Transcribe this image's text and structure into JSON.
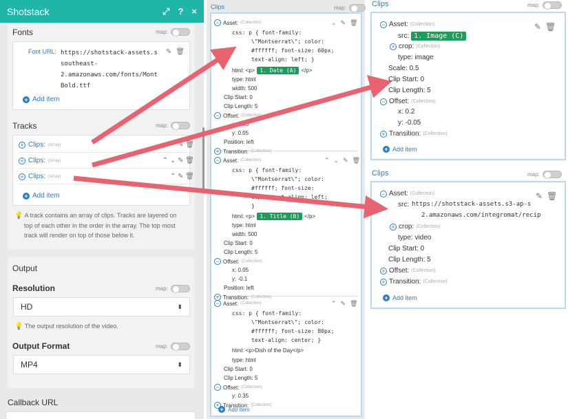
{
  "left": {
    "title": "Shotstack",
    "icons": {
      "expand": "⤢",
      "help": "?",
      "close": "×"
    },
    "fonts": {
      "heading": "Fonts",
      "map": "map:",
      "font_url_label": "Font URL:",
      "font_url_lines": [
        "https://shotstack-assets.s",
        "southeast-",
        "2.amazonaws.com/fonts/Mont",
        "Bold.ttf"
      ],
      "add_item": "Add item"
    },
    "tracks": {
      "heading": "Tracks",
      "map": "map:",
      "rows": [
        {
          "label": "Clips:",
          "type": "(Array)"
        },
        {
          "label": "Clips:",
          "type": "(Array)"
        },
        {
          "label": "Clips:",
          "type": "(Array)"
        }
      ],
      "add_item": "Add item",
      "hint": [
        "A track contains an array of clips. Tracks are layered on",
        "top of each other in the order in the array. The top most",
        "track will render on top of those below it."
      ]
    },
    "output": {
      "heading": "Output",
      "resolution_label": "Resolution",
      "map": "map:",
      "resolution_value": "HD",
      "resolution_hint": "The output resolution of the video.",
      "format_label": "Output Format",
      "format_value": "MP4"
    },
    "callback": {
      "label": "Callback URL"
    }
  },
  "mid": {
    "title": "Clips",
    "map": "map:",
    "add_item": "Add item",
    "clips": [
      {
        "asset": "Asset:",
        "coll": "(Collection)",
        "css": [
          "css: p { font-family:",
          "\\\"Montserrat\\\"; color:",
          "#ffffff; font-size: 60px;",
          "text-align: left; }"
        ],
        "html_pre": "html: <p>",
        "badge": "1. Date (A)",
        "html_post": "</p>",
        "type": "type: html",
        "width": "width: 500",
        "clip_start": "Clip Start: 0",
        "clip_length": "Clip Length: 5",
        "offset": "Offset:",
        "x": "x: 0.05",
        "y": "y: 0.05",
        "position": "Position: left",
        "transition": "Transition:"
      },
      {
        "asset": "Asset:",
        "coll": "(Collection)",
        "css": [
          "css: p { font-family:",
          "\\\"Montserrat\\\"; color:",
          "#ffffff; font-size:",
          "60px; text-align: left;",
          "}"
        ],
        "html_pre": "html: <p>",
        "badge": "1. Title (B)",
        "html_post": "</p>",
        "type": "type: html",
        "width": "width: 500",
        "clip_start": "Clip Start: 0",
        "clip_length": "Clip Length: 5",
        "offset": "Offset:",
        "x": "x: 0.05",
        "y": "y: -0.1",
        "position": "Position: left",
        "transition": "Transition:"
      },
      {
        "asset": "Asset:",
        "coll": "(Collection)",
        "css": [
          "css: p { font-family:",
          "\\\"Montserrat\\\"; color:",
          "#ffffff; font-size: 80px;",
          "text-align: center; }"
        ],
        "html_full": "html: <p>Dish of the Day</p>",
        "type": "type: html",
        "clip_start": "Clip Start: 0",
        "clip_length": "Clip Length: 5",
        "offset": "Offset:",
        "y": "y: 0.35",
        "transition": "Transition:"
      }
    ]
  },
  "right1": {
    "title": "Clips",
    "map": "map:",
    "asset": "Asset:",
    "coll": "(Collection)",
    "src_label": "src:",
    "src_badge": "1. Image (C)",
    "crop": "crop:",
    "type": "type: image",
    "scale": "Scale: 0.5",
    "clip_start": "Clip Start: 0",
    "clip_length": "Clip Length: 5",
    "offset": "Offset:",
    "x": "x: 0.2",
    "y": "y: -0.05",
    "transition": "Transition:",
    "add_item": "Add item"
  },
  "right2": {
    "title": "Clips",
    "map": "map:",
    "asset": "Asset:",
    "coll": "(Collection)",
    "src_label": "src:",
    "src_lines": [
      "https://shotstack-assets.s3-ap-s",
      "2.amazonaws.com/integromat/recip"
    ],
    "crop": "crop:",
    "type": "type: video",
    "clip_start": "Clip Start: 0",
    "clip_length": "Clip Length: 5",
    "offset": "Offset:",
    "transition": "Transition:",
    "add_item": "Add item"
  },
  "colors": {
    "teal": "#1fb5a8",
    "link": "#2a7cc7",
    "badge": "#1a9e5a",
    "arrow": "#e8636f"
  }
}
